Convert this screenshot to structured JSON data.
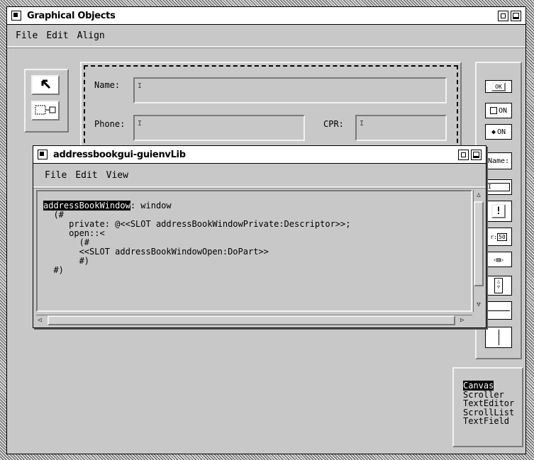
{
  "main_window": {
    "title": "Graphical Objects",
    "menu": [
      "File",
      "Edit",
      "Align"
    ]
  },
  "form": {
    "name_label": "Name:",
    "phone_label": "Phone:",
    "cpr_label": "CPR:"
  },
  "palette": {
    "ok_label": "OK",
    "checkbox_label": "ON",
    "radio_label": "ON",
    "name_label": "Name:",
    "slider_value": "50"
  },
  "child_window": {
    "title": "addressbookgui-guienvLib",
    "menu": [
      "File",
      "Edit",
      "View"
    ],
    "code": {
      "selected": "addressBookWindow",
      "line1_rest": ": window",
      "lines": [
        "  (#",
        "     private: @<<SLOT addressBookWindowPrivate:Descriptor>>;",
        "     open::<",
        "       (#",
        "       <<SLOT addressBookWindowOpen:DoPart>>",
        "       #)",
        "  #)"
      ]
    }
  },
  "type_list": {
    "items": [
      "Canvas",
      "Scroller",
      "TextEditor",
      "ScrollList",
      "TextField"
    ],
    "selected_index": 0
  }
}
